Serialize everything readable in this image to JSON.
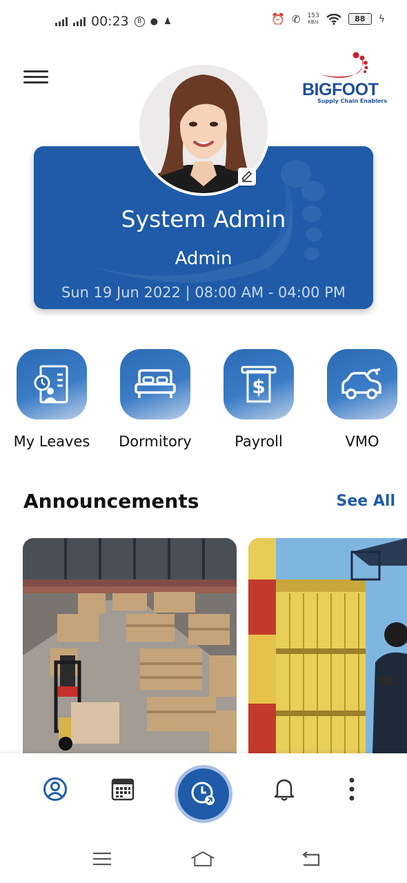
{
  "status_bar": {
    "time": "00:23",
    "net_speed_value": "153",
    "net_speed_unit": "KB/s",
    "battery": "88"
  },
  "header": {
    "logo_text": "BIGFOOT",
    "logo_tagline": "Supply Chain Enablers"
  },
  "profile": {
    "name": "System Admin",
    "role": "Admin",
    "shift": "Sun 19 Jun 2022 | 08:00 AM - 04:00 PM"
  },
  "quick_actions": [
    {
      "label": "My Leaves",
      "icon": "leave-document-icon"
    },
    {
      "label": "Dormitory",
      "icon": "bed-icon"
    },
    {
      "label": "Payroll",
      "icon": "payslip-dollar-icon"
    },
    {
      "label": "VMO",
      "icon": "car-wrench-icon"
    }
  ],
  "announcements": {
    "title": "Announcements",
    "see_all": "See All",
    "cards": [
      {
        "image": "warehouse-photo"
      },
      {
        "image": "shipping-containers-photo"
      }
    ]
  },
  "bottom_nav": {
    "items": [
      "profile-icon",
      "calendar-icon",
      "attendance-clock-icon",
      "bell-icon",
      "more-vertical-icon"
    ]
  },
  "colors": {
    "primary": "#1f5ba9",
    "accent_light": "#a9bfe6",
    "logo_red": "#c8202b"
  }
}
